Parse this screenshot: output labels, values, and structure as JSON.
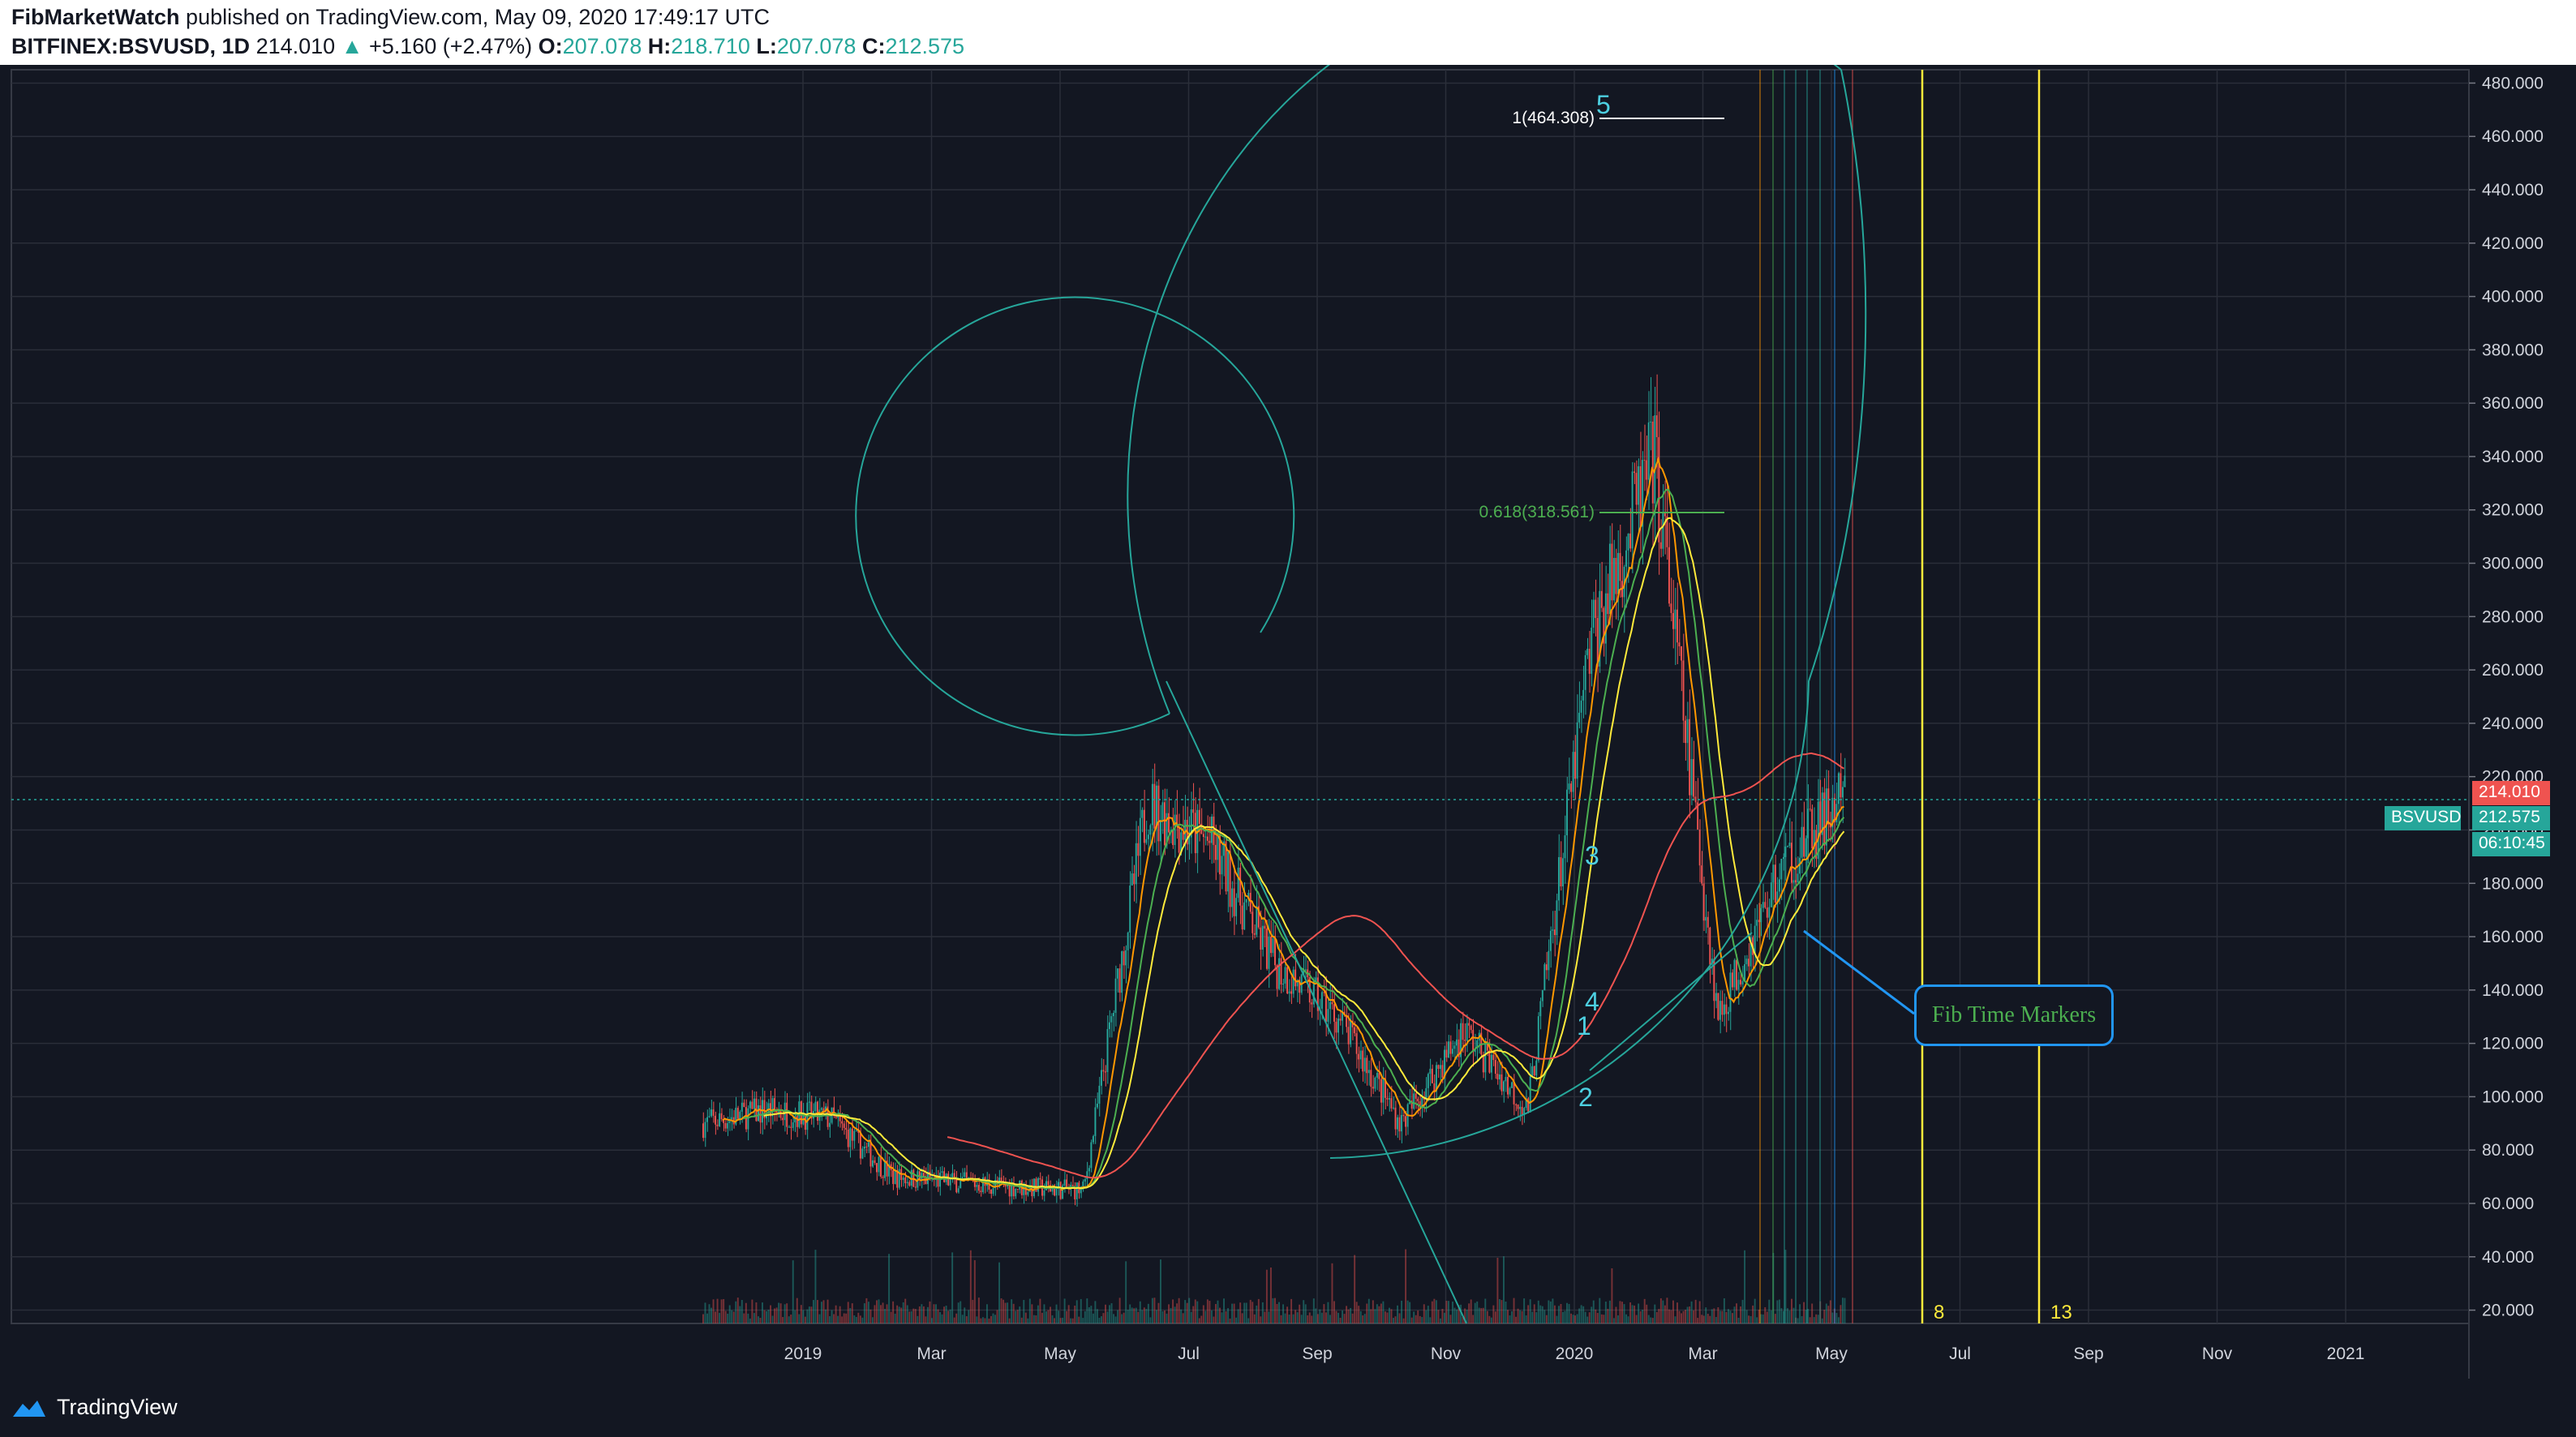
{
  "header": {
    "author": "FibMarketWatch",
    "published": "published on TradingView.com, May 09, 2020 17:49:17 UTC",
    "symbol": "BITFINEX:BSVUSD, 1D",
    "last": "214.010",
    "change": "+5.160 (+2.47%)",
    "o_label": "O:",
    "o": "207.078",
    "h_label": "H:",
    "h": "218.710",
    "l_label": "L:",
    "l": "207.078",
    "c_label": "C:",
    "c": "212.575"
  },
  "price_axis": {
    "ticks": [
      "480.000",
      "460.000",
      "440.000",
      "420.000",
      "400.000",
      "380.000",
      "360.000",
      "340.000",
      "320.000",
      "300.000",
      "280.000",
      "260.000",
      "240.000",
      "220.000",
      "200.000",
      "180.000",
      "160.000",
      "140.000",
      "120.000",
      "100.000",
      "80.000",
      "60.000",
      "40.000",
      "20.000"
    ],
    "last_price_tag": "214.010",
    "symbol_tag": "BSVUSD",
    "close_tag": "212.575",
    "countdown_tag": "06:10:45"
  },
  "time_axis": {
    "ticks": [
      "2019",
      "Mar",
      "May",
      "Jul",
      "Sep",
      "Nov",
      "2020",
      "Mar",
      "May",
      "Jul",
      "Sep",
      "Nov",
      "2021"
    ]
  },
  "annotations": {
    "fib_1": "1(464.308)",
    "fib_0618": "0.618(318.561)",
    "wave_1": "1",
    "wave_2": "2",
    "wave_3": "3",
    "wave_4": "4",
    "wave_5": "5",
    "fib_time_label": "Fib Time Markers",
    "marker_8": "8",
    "marker_13": "13"
  },
  "colors": {
    "background": "#131722",
    "up": "#26a69a",
    "down": "#ef5350",
    "spiral": "#26a69a",
    "fib_time": "#ffeb3b",
    "callout": "#2196f3"
  },
  "chart_data": {
    "type": "line",
    "symbol": "BITFINEX:BSVUSD",
    "interval": "1D",
    "ylim": [
      15,
      485
    ],
    "x": [
      "2018-11",
      "2018-12",
      "2019-01",
      "2019-02",
      "2019-03",
      "2019-04",
      "2019-05",
      "2019-06",
      "2019-07",
      "2019-08",
      "2019-09",
      "2019-10",
      "2019-11",
      "2019-12",
      "2020-01",
      "2020-02",
      "2020-03",
      "2020-04",
      "2020-05"
    ],
    "series": [
      {
        "name": "",
        "values": [
          90,
          95,
          92,
          70,
          68,
          66,
          65,
          210,
          195,
          150,
          130,
          90,
          125,
          95,
          270,
          340,
          130,
          185,
          212.575
        ]
      }
    ],
    "fib_levels": [
      {
        "label": "1(464.308)",
        "value": 464.308
      },
      {
        "label": "0.618(318.561)",
        "value": 318.561
      }
    ],
    "time_markers": [
      "8",
      "13"
    ]
  },
  "footer": {
    "brand": "TradingView"
  }
}
